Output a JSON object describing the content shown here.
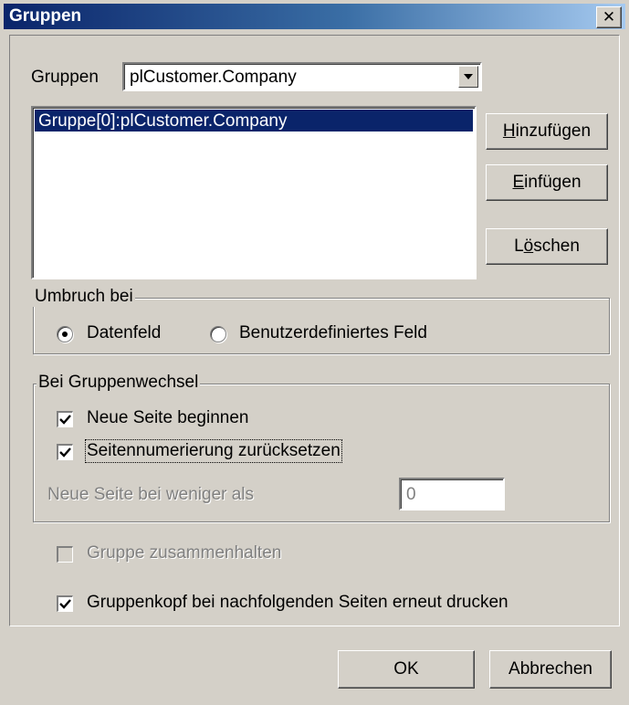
{
  "window": {
    "title": "Gruppen",
    "close_symbol": "✕"
  },
  "groups": {
    "label": "Gruppen",
    "selected": "plCustomer.Company",
    "list": [
      "Gruppe[0]:plCustomer.Company"
    ]
  },
  "buttons": {
    "add": {
      "pre": "",
      "accel": "H",
      "post": "inzufügen"
    },
    "insert": {
      "pre": "",
      "accel": "E",
      "post": "infügen"
    },
    "delete": {
      "pre": "L",
      "accel": "ö",
      "post": "schen"
    },
    "ok": "OK",
    "cancel": "Abbrechen"
  },
  "break_on": {
    "title": "Umbruch bei",
    "options": [
      {
        "label": "Datenfeld",
        "selected": true
      },
      {
        "label": "Benutzerdefiniertes Feld",
        "selected": false
      }
    ]
  },
  "group_change": {
    "title": "Bei Gruppenwechsel",
    "new_page": {
      "label": "Neue Seite beginnen",
      "checked": true
    },
    "reset_numbering": {
      "label": "Seitennumerierung zurücksetzen",
      "checked": true
    },
    "new_page_if_less": {
      "label": "Neue Seite bei weniger als",
      "value": "0"
    }
  },
  "keep_together": {
    "label": "Gruppe zusammenhalten",
    "checked": false,
    "enabled": false
  },
  "reprint_header": {
    "label": "Gruppenkopf bei nachfolgenden Seiten erneut drucken",
    "checked": true
  },
  "colors": {
    "face": "#d4d0c8",
    "selection": "#0a246a",
    "title_start": "#0a246a",
    "title_end": "#a6caf0"
  }
}
